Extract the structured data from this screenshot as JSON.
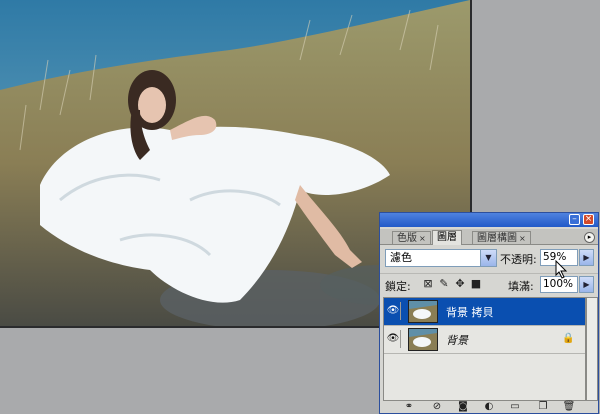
{
  "photo": {
    "description_icon": "photo-canvas"
  },
  "palette": {
    "tabs": [
      {
        "label": "色版"
      },
      {
        "label": "圖層"
      },
      {
        "label": "圖層構圖"
      }
    ],
    "blend_mode": "濾色",
    "opacity_label": "不透明:",
    "opacity_value": "59%",
    "lock_label": "鎖定:",
    "fill_label": "填滿:",
    "fill_value": "100%",
    "layers": [
      {
        "name": "背景 拷貝",
        "selected": true
      },
      {
        "name": "背景",
        "selected": false,
        "locked": true
      }
    ],
    "bottom_icons": [
      "link-icon",
      "fx-icon",
      "mask-icon",
      "adjustment-icon",
      "folder-icon",
      "new-layer-icon",
      "trash-icon"
    ]
  }
}
